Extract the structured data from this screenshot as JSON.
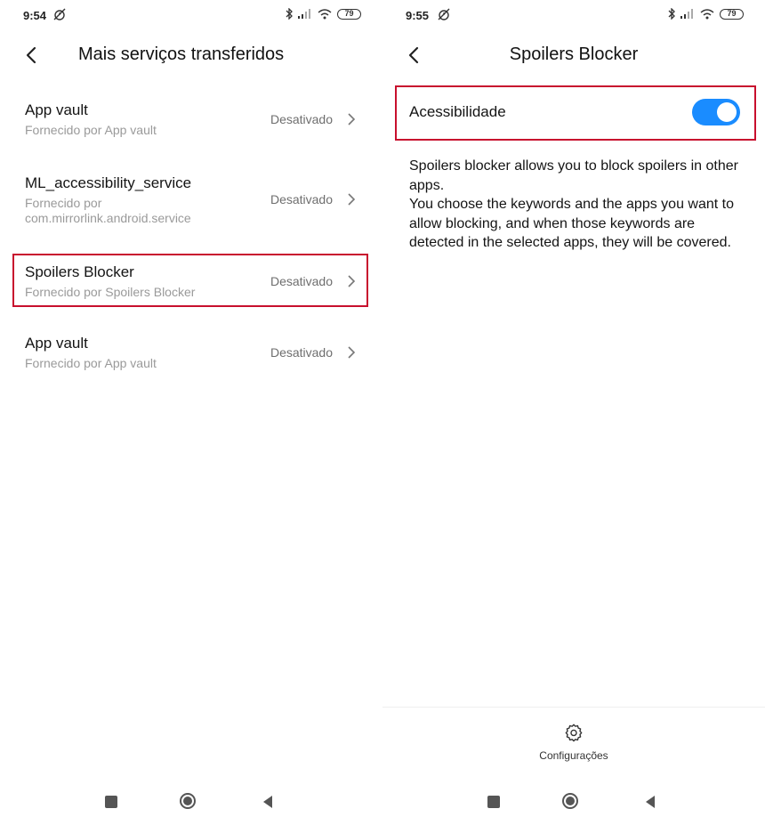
{
  "left_screen": {
    "status": {
      "time": "9:54",
      "battery": "79"
    },
    "title": "Mais serviços transferidos",
    "items": [
      {
        "name": "App vault",
        "provider": "Fornecido por App vault",
        "state": "Desativado"
      },
      {
        "name": "ML_accessibility_service",
        "provider_line1": "Fornecido por",
        "provider_line2": "com.mirrorlink.android.service",
        "state": "Desativado"
      },
      {
        "name": "Spoilers Blocker",
        "provider": "Fornecido por Spoilers Blocker",
        "state": "Desativado"
      },
      {
        "name": "App vault",
        "provider": "Fornecido por App vault",
        "state": "Desativado"
      }
    ]
  },
  "right_screen": {
    "status": {
      "time": "9:55",
      "battery": "79"
    },
    "title": "Spoilers Blocker",
    "accessibility_label": "Acessibilidade",
    "accessibility_enabled": true,
    "description_line1": "Spoilers blocker allows you to block spoilers in other apps.",
    "description_line2": "You choose the keywords and the apps you want to allow blocking, and when those keywords are detected in the selected apps, they will be covered.",
    "settings_label": "Configurações"
  },
  "colors": {
    "toggle_on": "#1a8cff",
    "highlight": "#c8102e"
  },
  "icons": [
    "alarm-off-icon",
    "bluetooth-icon",
    "signal-icon",
    "wifi-icon",
    "battery-icon",
    "back-arrow-icon",
    "chevron-right-icon",
    "gear-icon",
    "recents-icon",
    "home-icon",
    "back-nav-icon"
  ]
}
